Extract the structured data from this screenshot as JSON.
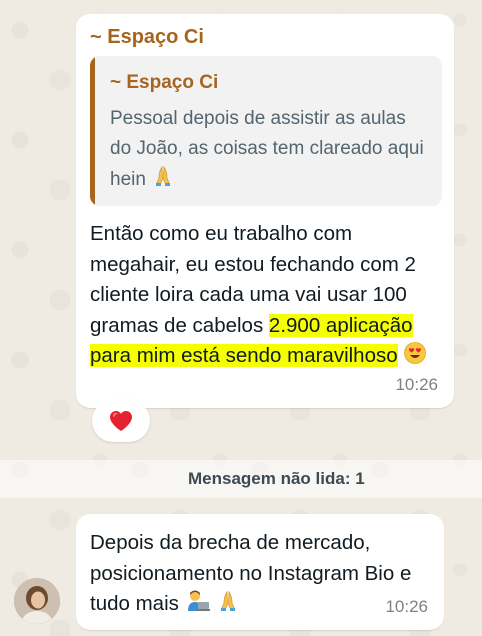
{
  "messages": [
    {
      "sender": "~ Espaço Ci",
      "quoted": {
        "sender": "~ Espaço Ci",
        "text": "Pessoal depois de assistir as aulas do João, as coisas tem clareado aqui hein",
        "emoji": "praying-hands"
      },
      "text_plain": "Então como eu trabalho com megahair, eu estou fechando com 2 cliente loira cada uma vai usar 100 gramas de cabelos",
      "text_highlighted": "2.900 aplicação para mim está sendo maravilhoso",
      "highlight_color": "#f5ff00",
      "emoji": "heart-eyes",
      "time": "10:26",
      "reaction": "red-heart"
    },
    {
      "text": "Depois da brecha de mercado, posicionamento no Instagram Bio e tudo mais",
      "emojis": [
        "technologist",
        "praying-hands"
      ],
      "time": "10:26"
    }
  ],
  "unread_divider": "Mensagem não lida: 1",
  "colors": {
    "sender": "#a5651f",
    "background": "#efeae2",
    "bubble": "#ffffff"
  }
}
